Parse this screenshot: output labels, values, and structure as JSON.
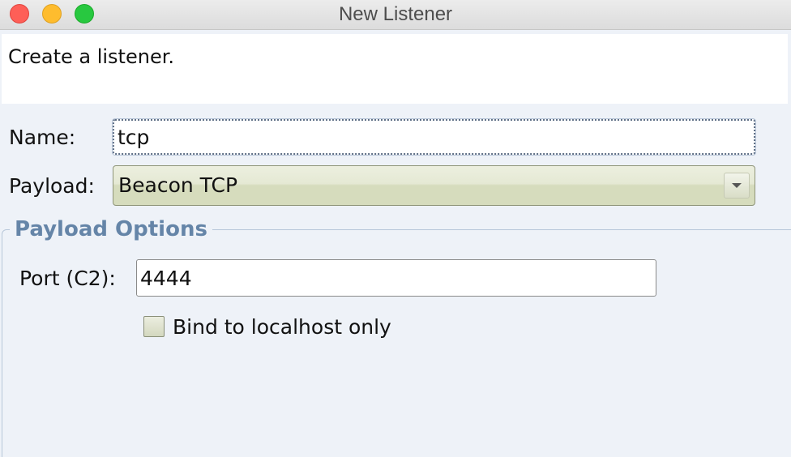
{
  "window": {
    "title": "New Listener"
  },
  "description": "Create a listener.",
  "form": {
    "name_label": "Name:",
    "name_value": "tcp",
    "payload_label": "Payload:",
    "payload_value": "Beacon TCP"
  },
  "payload_options": {
    "title": "Payload Options",
    "port_label": "Port (C2):",
    "port_value": "4444",
    "bind_localhost_label": "Bind to localhost only",
    "bind_localhost_checked": false
  },
  "colors": {
    "group_title": "#6585a8",
    "background": "#eef2f8",
    "select_fill": "#d6dcbd"
  }
}
